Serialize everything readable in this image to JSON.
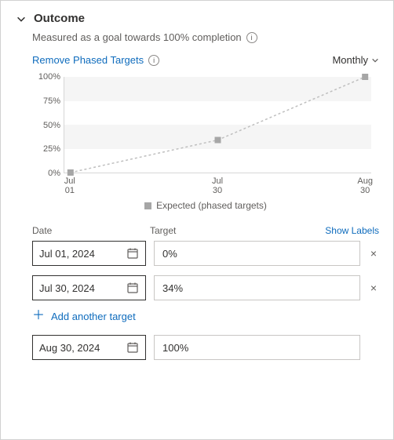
{
  "header": {
    "title": "Outcome",
    "subtitle": "Measured as a goal towards 100% completion"
  },
  "controls": {
    "remove_link": "Remove Phased Targets",
    "interval": "Monthly"
  },
  "chart_data": {
    "type": "line",
    "title": "",
    "xlabel": "",
    "ylabel": "",
    "ylim": [
      0,
      100
    ],
    "yticks": [
      "0%",
      "25%",
      "50%",
      "75%",
      "100%"
    ],
    "x_ticks": [
      "Jul\n01",
      "Jul\n30",
      "Aug\n30"
    ],
    "series": [
      {
        "name": "Expected (phased targets)",
        "x": [
          "Jul 01",
          "Jul 30",
          "Aug 30"
        ],
        "values": [
          0,
          34,
          100
        ]
      }
    ]
  },
  "legend": {
    "label": "Expected (phased targets)"
  },
  "table": {
    "headers": {
      "date": "Date",
      "target": "Target",
      "show_labels": "Show Labels"
    },
    "rows": [
      {
        "date": "Jul 01, 2024",
        "target": "0%",
        "removable": true
      },
      {
        "date": "Jul 30, 2024",
        "target": "34%",
        "removable": true
      }
    ],
    "add_label": "Add another target",
    "final": {
      "date": "Aug 30, 2024",
      "target": "100%"
    }
  }
}
